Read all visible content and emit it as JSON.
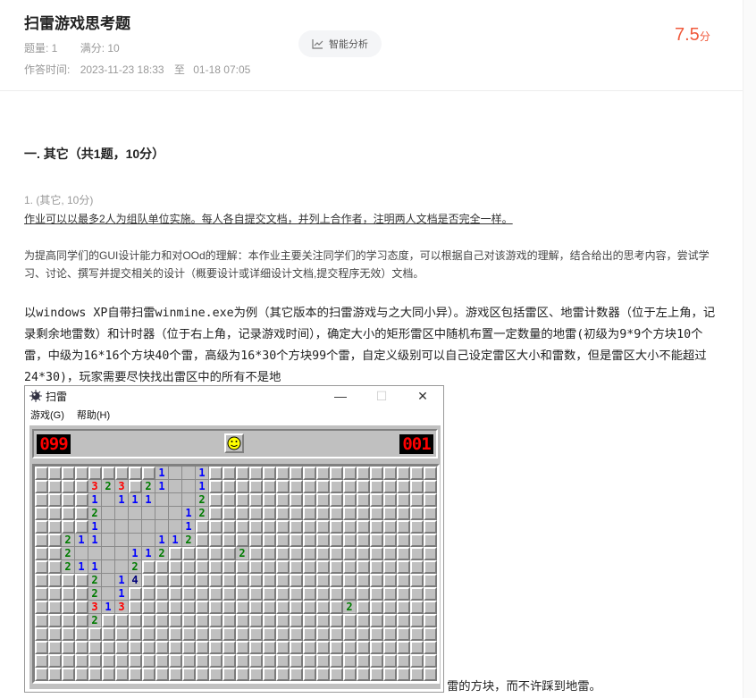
{
  "header": {
    "title": "扫雷游戏思考题",
    "question_count_label": "题量: 1",
    "full_score_label": "满分: 10",
    "time_label": "作答时间:",
    "time_start": "2023-11-23 18:33",
    "time_to": "至",
    "time_end": "01-18 07:05",
    "ai_button": "智能分析",
    "score_value": "7.5",
    "score_unit": "分"
  },
  "section": {
    "title": "一. 其它（共1题，10分）"
  },
  "question": {
    "head": "1. (其它, 10分)",
    "note": "作业可以以最多2人为组队单位实施。每人各自提交文档，并列上合作者，注明两人文档是否完全一样。",
    "intro": "为提高同学们的GUI设计能力和对OOd的理解：本作业主要关注同学们的学习态度，可以根据自己对该游戏的理解，结合给出的思考内容，尝试学习、讨论、撰写并提交相关的设计（概要设计或详细设计文档,提交程序无效）文档。",
    "body": "以windows XP自带扫雷winmine.exe为例（其它版本的扫雷游戏与之大同小异）。游戏区包括雷区、地雷计数器（位于左上角，记录剩余地雷数）和计时器（位于右上角，记录游戏时间），确定大小的矩形雷区中随机布置一定数量的地雷(初级为9*9个方块10个雷，中级为16*16个方块40个雷，高级为16*30个方块99个雷，自定义级别可以自己设定雷区大小和雷数，但是雷区大小不能超过24*30)，玩家需要尽快找出雷区中的所有不是地",
    "tail": "雷的方块，而不许踩到地雷。"
  },
  "minesweeper": {
    "window_title": "扫雷",
    "minimize": "—",
    "maximize": "☐",
    "close": "✕",
    "menu": [
      "游戏(G)",
      "帮助(H)"
    ],
    "mine_counter": "099",
    "timer": "001",
    "face": "smiley-face",
    "opened_cells": [
      {
        "r": 0,
        "c": 9,
        "v": "1"
      },
      {
        "r": 0,
        "c": 10,
        "v": ""
      },
      {
        "r": 0,
        "c": 11,
        "v": ""
      },
      {
        "r": 0,
        "c": 12,
        "v": "1"
      },
      {
        "r": 1,
        "c": 4,
        "v": "3"
      },
      {
        "r": 1,
        "c": 5,
        "v": "2"
      },
      {
        "r": 1,
        "c": 6,
        "v": "3"
      },
      {
        "r": 1,
        "c": 8,
        "v": "2"
      },
      {
        "r": 1,
        "c": 9,
        "v": "1"
      },
      {
        "r": 1,
        "c": 10,
        "v": ""
      },
      {
        "r": 1,
        "c": 11,
        "v": ""
      },
      {
        "r": 1,
        "c": 12,
        "v": "1"
      },
      {
        "r": 2,
        "c": 4,
        "v": "1"
      },
      {
        "r": 2,
        "c": 5,
        "v": ""
      },
      {
        "r": 2,
        "c": 6,
        "v": "1"
      },
      {
        "r": 2,
        "c": 7,
        "v": "1"
      },
      {
        "r": 2,
        "c": 8,
        "v": "1"
      },
      {
        "r": 2,
        "c": 9,
        "v": ""
      },
      {
        "r": 2,
        "c": 10,
        "v": ""
      },
      {
        "r": 2,
        "c": 11,
        "v": ""
      },
      {
        "r": 2,
        "c": 12,
        "v": "2"
      },
      {
        "r": 3,
        "c": 4,
        "v": "2"
      },
      {
        "r": 3,
        "c": 5,
        "v": ""
      },
      {
        "r": 3,
        "c": 6,
        "v": ""
      },
      {
        "r": 3,
        "c": 7,
        "v": ""
      },
      {
        "r": 3,
        "c": 8,
        "v": ""
      },
      {
        "r": 3,
        "c": 9,
        "v": ""
      },
      {
        "r": 3,
        "c": 10,
        "v": ""
      },
      {
        "r": 3,
        "c": 11,
        "v": "1"
      },
      {
        "r": 3,
        "c": 12,
        "v": "2"
      },
      {
        "r": 4,
        "c": 4,
        "v": "1"
      },
      {
        "r": 4,
        "c": 5,
        "v": ""
      },
      {
        "r": 4,
        "c": 6,
        "v": ""
      },
      {
        "r": 4,
        "c": 7,
        "v": ""
      },
      {
        "r": 4,
        "c": 8,
        "v": ""
      },
      {
        "r": 4,
        "c": 9,
        "v": ""
      },
      {
        "r": 4,
        "c": 10,
        "v": ""
      },
      {
        "r": 4,
        "c": 11,
        "v": "1"
      },
      {
        "r": 5,
        "c": 2,
        "v": "2"
      },
      {
        "r": 5,
        "c": 3,
        "v": "1"
      },
      {
        "r": 5,
        "c": 4,
        "v": "1"
      },
      {
        "r": 5,
        "c": 5,
        "v": ""
      },
      {
        "r": 5,
        "c": 6,
        "v": ""
      },
      {
        "r": 5,
        "c": 7,
        "v": ""
      },
      {
        "r": 5,
        "c": 8,
        "v": ""
      },
      {
        "r": 5,
        "c": 9,
        "v": "1"
      },
      {
        "r": 5,
        "c": 10,
        "v": "1"
      },
      {
        "r": 5,
        "c": 11,
        "v": "2"
      },
      {
        "r": 6,
        "c": 2,
        "v": "2"
      },
      {
        "r": 6,
        "c": 3,
        "v": ""
      },
      {
        "r": 6,
        "c": 4,
        "v": ""
      },
      {
        "r": 6,
        "c": 5,
        "v": ""
      },
      {
        "r": 6,
        "c": 6,
        "v": ""
      },
      {
        "r": 6,
        "c": 7,
        "v": "1"
      },
      {
        "r": 6,
        "c": 8,
        "v": "1"
      },
      {
        "r": 6,
        "c": 9,
        "v": "2"
      },
      {
        "r": 6,
        "c": 15,
        "v": "2"
      },
      {
        "r": 7,
        "c": 2,
        "v": "2"
      },
      {
        "r": 7,
        "c": 3,
        "v": "1"
      },
      {
        "r": 7,
        "c": 4,
        "v": "1"
      },
      {
        "r": 7,
        "c": 5,
        "v": ""
      },
      {
        "r": 7,
        "c": 6,
        "v": ""
      },
      {
        "r": 7,
        "c": 7,
        "v": "2"
      },
      {
        "r": 8,
        "c": 4,
        "v": "2"
      },
      {
        "r": 8,
        "c": 5,
        "v": ""
      },
      {
        "r": 8,
        "c": 6,
        "v": "1"
      },
      {
        "r": 8,
        "c": 7,
        "v": "4"
      },
      {
        "r": 9,
        "c": 4,
        "v": "2"
      },
      {
        "r": 9,
        "c": 5,
        "v": ""
      },
      {
        "r": 9,
        "c": 6,
        "v": "1"
      },
      {
        "r": 10,
        "c": 4,
        "v": "3"
      },
      {
        "r": 10,
        "c": 5,
        "v": "1"
      },
      {
        "r": 10,
        "c": 6,
        "v": "3"
      },
      {
        "r": 10,
        "c": 23,
        "v": "2"
      },
      {
        "r": 11,
        "c": 4,
        "v": "2"
      }
    ],
    "number_colors": {
      "1": "#0000ff",
      "2": "#007b00",
      "3": "#ff0000",
      "4": "#00007b"
    }
  }
}
